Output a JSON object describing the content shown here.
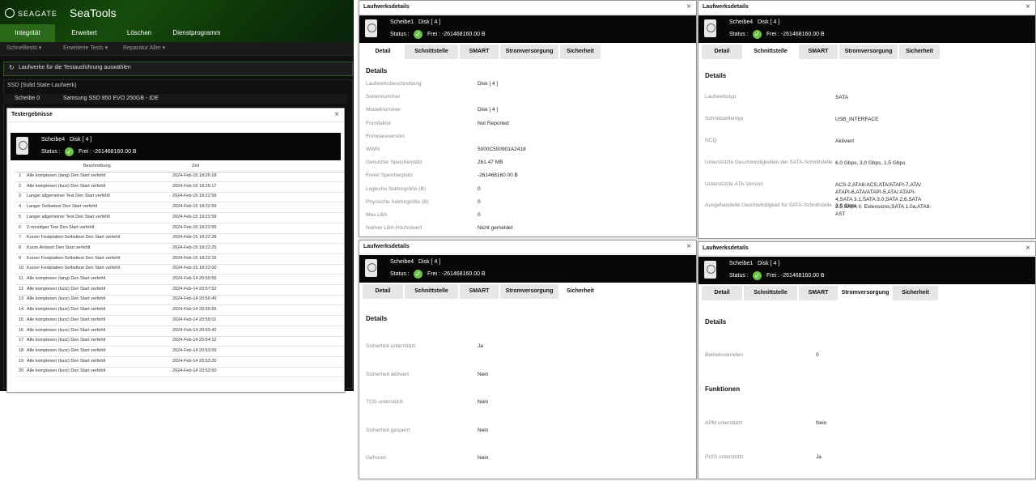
{
  "seatools": {
    "brand": "SEAGATE",
    "app_title": "SeaTools",
    "tabs": [
      "Integrität",
      "Erweitert",
      "Löschen",
      "Dienstprogramm"
    ],
    "subnav": [
      "Schnelltests",
      "Erweiterte Tests",
      "Reparatur Aller"
    ],
    "select_drives_label": "Laufwerke für die Testausführung auswählen",
    "group_title": "SSD (Solid State-Laufwerk)",
    "drive_name": "Scheibe 0",
    "drive_model": "Samsung SSD 850 EVO 250GB - IDE"
  },
  "test_results": {
    "title": "Testergebnisse",
    "drive": "Scheibe4",
    "disk": "Disk [ 4 ]",
    "status_label": "Status :",
    "frei": "Frei : -261468160.00 B",
    "col_desc": "Beschreibung",
    "col_time": "Zeit",
    "rows": [
      {
        "n": "1",
        "d": "Alle komplexen (lang) Den Start verfehlt",
        "t": "2024-Feb-15 18:26:18"
      },
      {
        "n": "2",
        "d": "Alle komplexen (kurz) Den Start verfehlt",
        "t": "2024-Feb-15 18:26:17"
      },
      {
        "n": "3",
        "d": "Langer allgemeiner Test Den Start verfehlt",
        "t": "2024-Feb-15 18:22:59"
      },
      {
        "n": "4",
        "d": "Langer Selbsttest Den Start verfehlt",
        "t": "2024-Feb-15 18:22:59"
      },
      {
        "n": "5",
        "d": "Langer allgemeiner Test Den Start verfehlt",
        "t": "2024-Feb-15 18:22:58"
      },
      {
        "n": "6",
        "d": "2-minütiger Test Den Start verfehlt",
        "t": "2024-Feb-15 18:22:55"
      },
      {
        "n": "7",
        "d": "Kurzer Festplatten-Selbsttest Den Start verfehlt",
        "t": "2024-Feb-15 18:22:28"
      },
      {
        "n": "8",
        "d": "Kurze Antwort Den Start verfehlt",
        "t": "2024-Feb-15 18:22:25"
      },
      {
        "n": "9",
        "d": "Kurzer Festplatten-Selbsttest Den Start verfehlt",
        "t": "2024-Feb-15 18:22:15"
      },
      {
        "n": "10",
        "d": "Kurzer Festplatten-Selbsttest Den Start verfehlt",
        "t": "2024-Feb-15 18:22:00"
      },
      {
        "n": "11",
        "d": "Alle komplexen (lang) Den Start verfehlt",
        "t": "2024-Feb-14 20:59:55"
      },
      {
        "n": "12",
        "d": "Alle komplexen (kurz) Den Start verfehlt",
        "t": "2024-Feb-14 20:57:52"
      },
      {
        "n": "13",
        "d": "Alle komplexen (kurz) Den Start verfehlt",
        "t": "2024-Feb-14 20:56:49"
      },
      {
        "n": "14",
        "d": "Alle komplexen (kurz) Den Start verfehlt",
        "t": "2024-Feb-14 20:55:55"
      },
      {
        "n": "15",
        "d": "Alle komplexen (kurz) Den Start verfehlt",
        "t": "2024-Feb-14 20:55:01"
      },
      {
        "n": "16",
        "d": "Alle komplexen (kurz) Den Start verfehlt",
        "t": "2024-Feb-14 20:55:42"
      },
      {
        "n": "17",
        "d": "Alle komplexen (kurz) Den Start verfehlt",
        "t": "2024-Feb-14 20:54:12"
      },
      {
        "n": "18",
        "d": "Alle komplexen (kurz) Den Start verfehlt",
        "t": "2024-Feb-14 20:53:59"
      },
      {
        "n": "19",
        "d": "Alle komplexen (kurz) Den Start verfehlt",
        "t": "2024-Feb-14 20:53:20"
      },
      {
        "n": "20",
        "d": "Alle komplexen (kurz) Den Start verfehlt",
        "t": "2024-Feb-14 20:53:50"
      }
    ]
  },
  "common": {
    "window_title": "Laufwerksdetails",
    "disk": "Disk [ 4 ]",
    "status_label": "Status :",
    "frei": "Frei : -261468160.00 B",
    "tabs": [
      "Detail",
      "Schnittstelle",
      "SMART",
      "Stromversorgung",
      "Sicherheit"
    ],
    "details_title": "Details",
    "functions_title": "Funktionen"
  },
  "detail_panel": {
    "drive": "Scheibe1",
    "rows": [
      {
        "label": "Laufwerksbeschreibung",
        "value": "Disk [ 4 ]"
      },
      {
        "label": "Seriennummer",
        "value": ""
      },
      {
        "label": "Modellnummer",
        "value": "Disk [ 4 ]"
      },
      {
        "label": "Formfaktor",
        "value": "Not Reported"
      },
      {
        "label": "Firmwareversion",
        "value": ""
      },
      {
        "label": "WWN",
        "value": "5000C500901A2418"
      },
      {
        "label": "Genutzter Speicherplatz",
        "value": "261.47 MB"
      },
      {
        "label": "Freier Speicherplatz",
        "value": "-261468160.00 B"
      },
      {
        "label": "Logische Sektorgröße (B)",
        "value": "0"
      },
      {
        "label": "Physische Sektorgröße (B)",
        "value": "0"
      },
      {
        "label": "Max LBA",
        "value": "0"
      },
      {
        "label": "Nativer LBA-Höchstwert",
        "value": "Nicht gemeldet"
      }
    ]
  },
  "interface_panel": {
    "drive": "Scheibe4",
    "rows": [
      {
        "label": "Laufwerkstyp",
        "value": "SATA"
      },
      {
        "label": "Schnittstellentyp",
        "value": "USB_INTERFACE"
      },
      {
        "label": "NCQ",
        "value": "Aktiviert"
      },
      {
        "label": "Unterstützte Geschwindigkeiten der SATA-Schnittstelle",
        "value": "6.0 Gbps, 3.0 Gbps, 1.5 Gbps"
      },
      {
        "label": "Unterstützte ATA-Version",
        "value": "ACS-2,ATA8-ACS,ATA/ATAPI-7,ATA/ ATAPI-6,ATA/ATAPI-5,ATA/ ATAPI-4,SATA 3.1,SATA 3.0,SATA 2.6,SATA 2.5,SATA II: Extensions,SATA 1.0a,ATA8-AST"
      },
      {
        "label": "Ausgehandelte Geschwindigkeit für SATA-Schnittstelle",
        "value": "3.0 Gbps"
      }
    ]
  },
  "security_panel": {
    "drive": "Scheibe4",
    "rows": [
      {
        "label": "Sicherheit unterstützt",
        "value": "Ja"
      },
      {
        "label": "Sicherheit aktiviert",
        "value": "Nein"
      },
      {
        "label": "TCG unterstützt",
        "value": "Nein"
      },
      {
        "label": "Sicherheit gesperrt",
        "value": "Nein"
      },
      {
        "label": "Gefroren",
        "value": "Nein"
      }
    ]
  },
  "power_panel": {
    "drive": "Scheibe1",
    "rows": [
      {
        "label": "Betriebsstunden",
        "value": "0"
      }
    ],
    "func_rows": [
      {
        "label": "APM unterstützt",
        "value": "Nein"
      },
      {
        "label": "PUIS unterstützt",
        "value": "Ja"
      }
    ]
  },
  "colors": {
    "seagate_green": "#2b6a1a",
    "status_ok": "#6cc24a",
    "header_bg": "#080808"
  }
}
